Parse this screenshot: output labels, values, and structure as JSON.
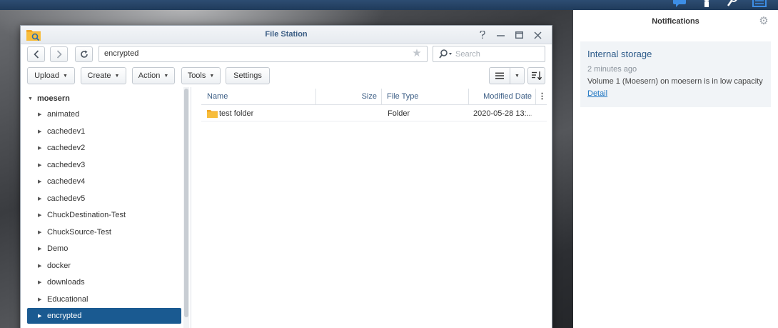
{
  "window": {
    "title": "File Station"
  },
  "toolbar": {
    "path": "encrypted",
    "search_placeholder": "Search",
    "buttons": {
      "upload": "Upload",
      "create": "Create",
      "action": "Action",
      "tools": "Tools",
      "settings": "Settings"
    }
  },
  "sidebar": {
    "root": "moesern",
    "items": [
      "animated",
      "cachedev1",
      "cachedev2",
      "cachedev3",
      "cachedev4",
      "cachedev5",
      "ChuckDestination-Test",
      "ChuckSource-Test",
      "Demo",
      "docker",
      "downloads",
      "Educational",
      "encrypted"
    ],
    "selected": "encrypted"
  },
  "file_list": {
    "columns": {
      "name": "Name",
      "size": "Size",
      "type": "File Type",
      "modified": "Modified Date"
    },
    "rows": [
      {
        "name": "test folder",
        "size": "",
        "type": "Folder",
        "modified": "2020-05-28 13:..."
      }
    ]
  },
  "notifications": {
    "title": "Notifications",
    "items": [
      {
        "heading": "Internal storage",
        "time": "2 minutes ago",
        "message": "Volume 1 (Moesern) on moesern is in low capacity",
        "link": "Detail"
      }
    ]
  },
  "colors": {
    "selection": "#1a5a91",
    "link": "#1f76c2",
    "accent": "#3b5d84"
  },
  "icons": {
    "folder": "folder-icon",
    "search": "search-icon",
    "star": "star-icon",
    "refresh": "refresh-icon",
    "gear": "gear-icon"
  }
}
